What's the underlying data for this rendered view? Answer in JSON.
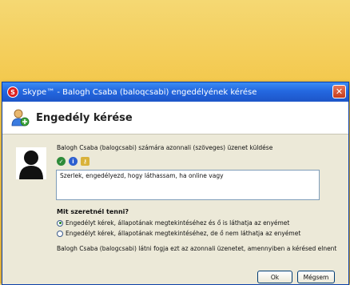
{
  "window": {
    "title": "Skype™ - Balogh Csaba (baloqcsabi) engedélyének kérése",
    "close_glyph": "✕"
  },
  "header": {
    "title": "Engedély kérése",
    "icon": "add-contact-icon"
  },
  "request": {
    "intro": "Balogh Csaba (balogcsabi) számára azonnali (szöveges) üzenet küldése",
    "status_icons": [
      "online-status-icon",
      "info-icon",
      "lock-icon"
    ],
    "message": "Szerlek, engedélyezd, hogy láthassam, ha online vagy"
  },
  "choice": {
    "question": "Mit szeretnél tenni?",
    "options": [
      {
        "label": "Engedélyt kérek, állapotának megtekintéséhez és ő is láthatja az enyémet",
        "selected": true
      },
      {
        "label": "Engedélyt kérek, állapotának megtekintéséhez, de ő nem láthatja az enyémet",
        "selected": false
      }
    ]
  },
  "note": "Balogh Csaba (balogcsabi) látni fogja ezt az azonnali üzenetet, amennyiben a kérésed elnent",
  "buttons": {
    "ok": "Ok",
    "cancel": "Mégsem"
  },
  "colors": {
    "titlebar": "#2468e0",
    "background": "#f3c84c",
    "dialog": "#ece9d8"
  }
}
